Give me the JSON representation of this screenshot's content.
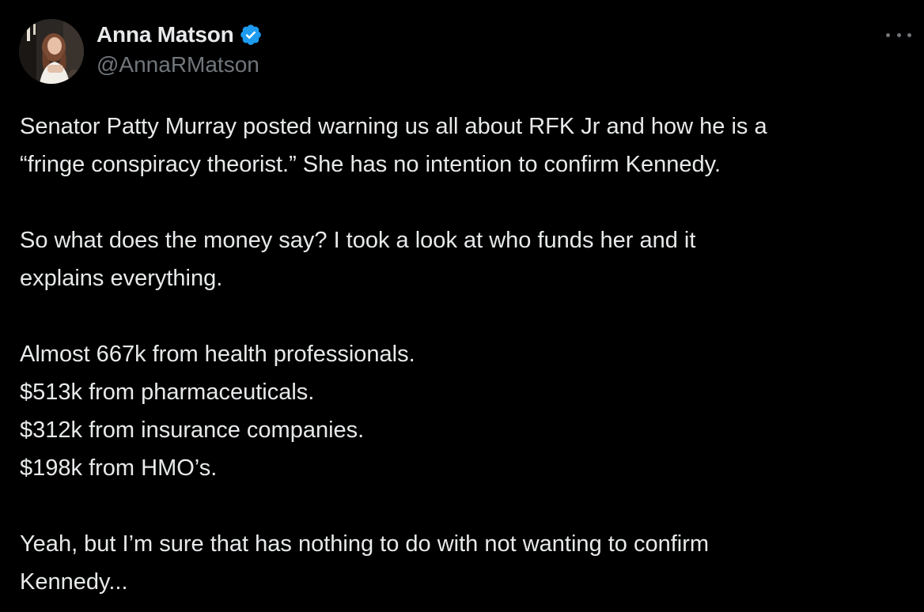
{
  "tweet": {
    "author_name": "Anna Matson",
    "author_handle": "@AnnaRMatson",
    "verified_icon": "verified-badge-icon",
    "more_icon": "more-options-icon",
    "colors": {
      "background": "#000000",
      "text": "#e7e9ea",
      "muted": "#71767b",
      "verified": "#1d9bf0"
    },
    "paragraphs": [
      "Senator Patty Murray posted warning us all about RFK Jr and how he is a\n“fringe conspiracy theorist.” She has no intention to confirm Kennedy.",
      "So what does the money say? I took a look at who funds her and it\nexplains everything.",
      "Almost 667k from health professionals.\n$513k from pharmaceuticals.\n$312k from insurance companies.\n$198k from HMO’s.",
      "Yeah, but I’m sure that has nothing to do with not wanting to confirm\nKennedy..."
    ]
  }
}
